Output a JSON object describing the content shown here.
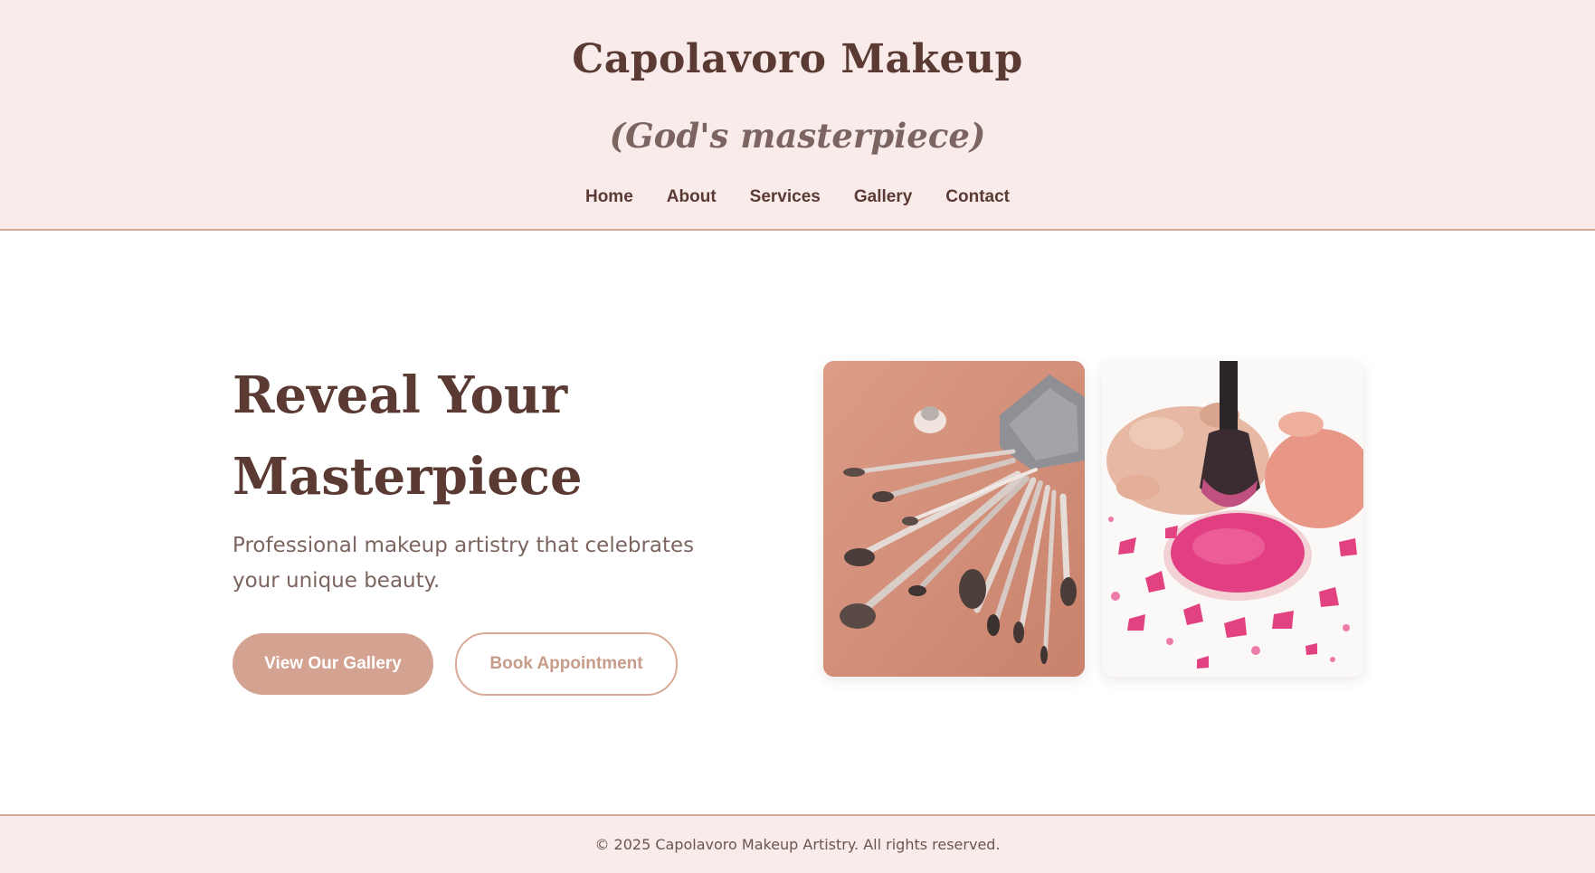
{
  "header": {
    "brand_title": "Capolavoro Makeup",
    "brand_subtitle": "(God's masterpiece)",
    "nav": [
      "Home",
      "About",
      "Services",
      "Gallery",
      "Contact"
    ]
  },
  "hero": {
    "heading_line1": "Reveal Your",
    "heading_line2": "Masterpiece",
    "tagline": "Professional makeup artistry that celebrates your unique beauty.",
    "primary_button": "View Our Gallery",
    "secondary_button": "Book Appointment",
    "images": [
      {
        "name": "makeup-brushes-photo"
      },
      {
        "name": "pink-powder-photo"
      }
    ]
  },
  "footer": {
    "copyright": "© 2025 Capolavoro Makeup Artistry. All rights reserved."
  },
  "colors": {
    "header_bg": "#f8ebea",
    "accent": "#d4a291",
    "border": "#d9ab97",
    "text_dark": "#5a3a32",
    "text_muted": "#7c6560"
  }
}
